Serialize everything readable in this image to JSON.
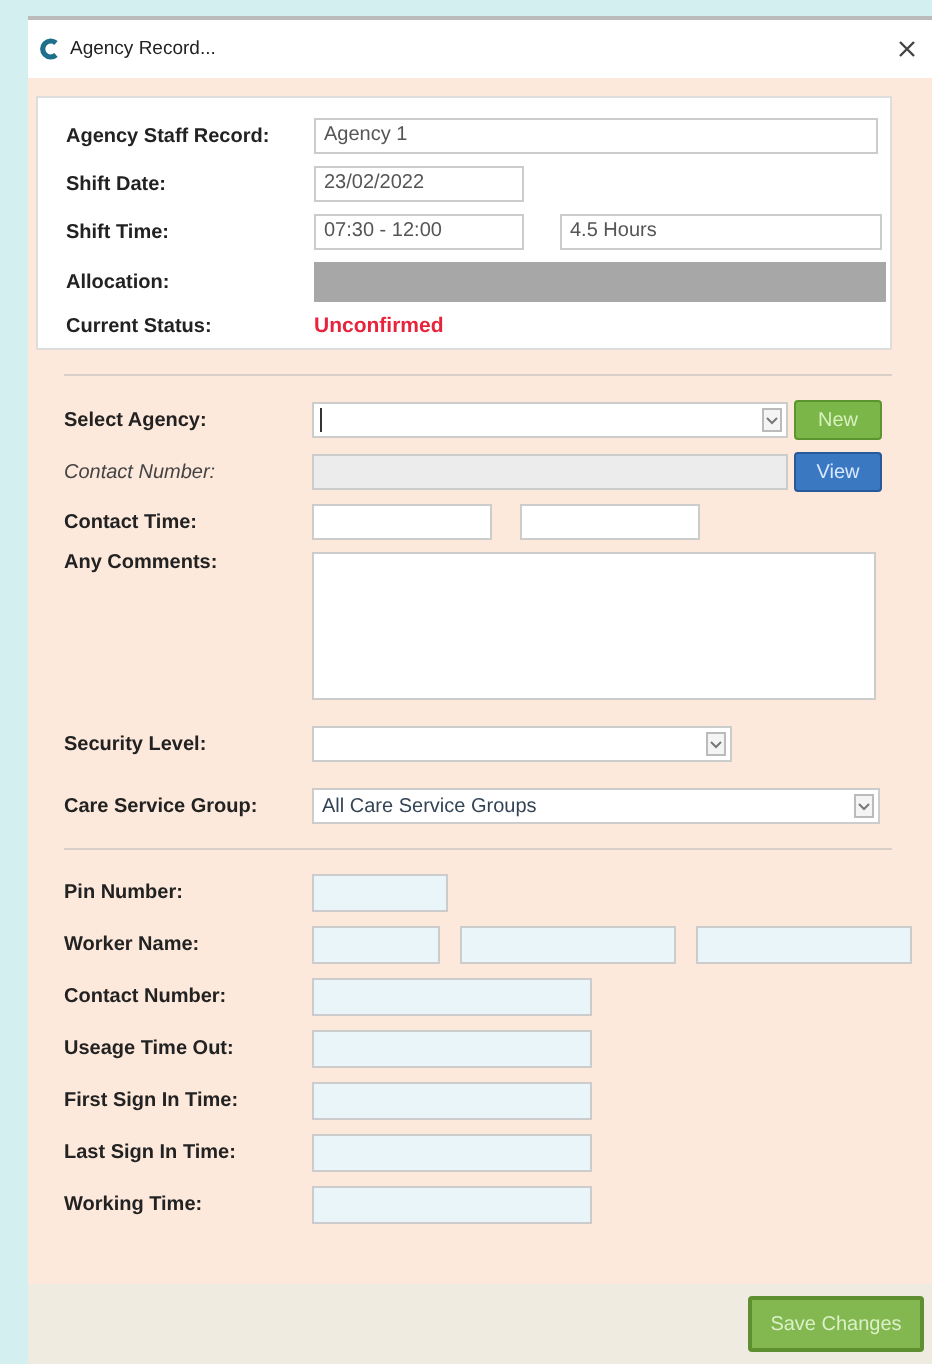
{
  "window": {
    "title": "Agency Record..."
  },
  "record": {
    "agency_staff_record": {
      "label": "Agency Staff Record:",
      "value": "Agency 1"
    },
    "shift_date": {
      "label": "Shift Date:",
      "value": "23/02/2022"
    },
    "shift_time": {
      "label": "Shift Time:",
      "value": "07:30 - 12:00",
      "duration": "4.5 Hours"
    },
    "allocation": {
      "label": "Allocation:"
    },
    "current_status": {
      "label": "Current Status:",
      "value": "Unconfirmed"
    }
  },
  "agency": {
    "select_agency": {
      "label": "Select Agency:",
      "new_button": "New"
    },
    "contact_number": {
      "label": "Contact Number:",
      "view_button": "View"
    },
    "contact_time": {
      "label": "Contact Time:"
    },
    "any_comments": {
      "label": "Any Comments:"
    },
    "security_level": {
      "label": "Security Level:"
    },
    "care_service_group": {
      "label": "Care Service Group:",
      "value": "All Care Service Groups"
    }
  },
  "worker": [
    {
      "label": "Pin Number:",
      "kind": "short"
    },
    {
      "label": "Worker Name:",
      "kind": "name"
    },
    {
      "label": "Contact Number:",
      "kind": "wide"
    },
    {
      "label": "Useage Time Out:",
      "kind": "wide"
    },
    {
      "label": "First Sign In Time:",
      "kind": "wide"
    },
    {
      "label": "Last Sign In Time:",
      "kind": "wide"
    },
    {
      "label": "Working Time:",
      "kind": "wide"
    }
  ],
  "save_button": "Save Changes"
}
